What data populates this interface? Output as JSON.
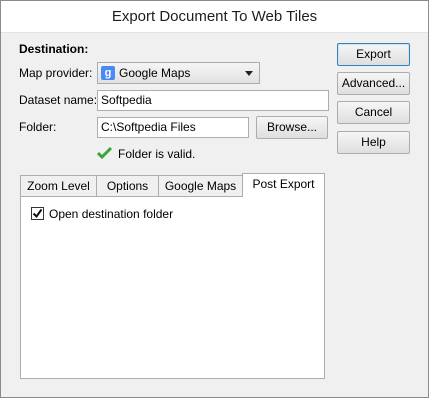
{
  "window": {
    "title": "Export Document To Web Tiles"
  },
  "destination": {
    "heading": "Destination:",
    "map_provider": {
      "label": "Map provider:",
      "value": "Google Maps",
      "icon": "google-maps-icon"
    },
    "dataset_name": {
      "label": "Dataset name:",
      "value": "Softpedia"
    },
    "folder": {
      "label": "Folder:",
      "value": "C:\\Softpedia Files",
      "browse_label": "Browse..."
    },
    "status": {
      "text": "Folder is valid.",
      "icon": "checkmark-icon",
      "color": "#3aa63a"
    }
  },
  "buttons": {
    "export": "Export",
    "advanced": "Advanced...",
    "cancel": "Cancel",
    "help": "Help"
  },
  "tabs": [
    {
      "label": "Zoom Level"
    },
    {
      "label": "Options"
    },
    {
      "label": "Google Maps"
    },
    {
      "label": "Post Export",
      "active": true
    }
  ],
  "post_export": {
    "open_folder": {
      "label": "Open destination folder",
      "checked": true
    }
  }
}
